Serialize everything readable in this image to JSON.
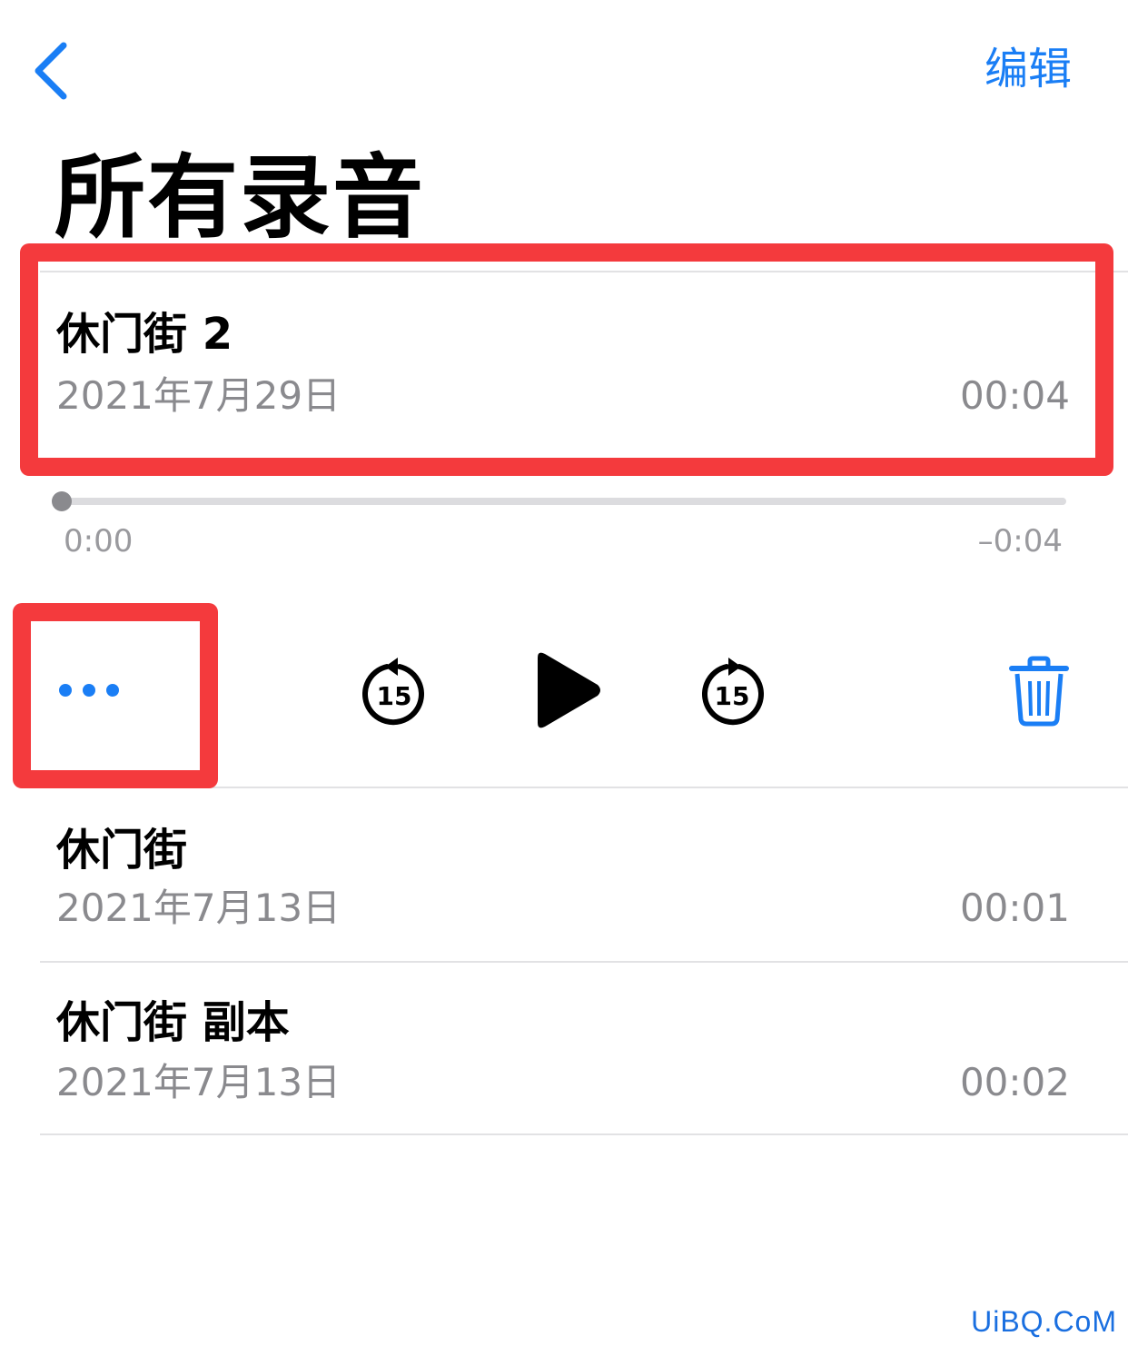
{
  "nav": {
    "back_icon": "chevron-left-icon",
    "edit_label": "编辑",
    "accent_color": "#1a7ef5"
  },
  "title": "所有录音",
  "recordings": [
    {
      "title": "休门街 2",
      "date": "2021年7月29日",
      "duration": "00:04"
    },
    {
      "title": "休门街",
      "date": "2021年7月13日",
      "duration": "00:01"
    },
    {
      "title": "休门街 副本",
      "date": "2021年7月13日",
      "duration": "00:02"
    }
  ],
  "player": {
    "elapsed": "0:00",
    "remaining": "–0:04",
    "progress": 0,
    "skip_back_label": "15",
    "skip_forward_label": "15",
    "icons": [
      "more-icon",
      "skip-back-15-icon",
      "play-icon",
      "skip-forward-15-icon",
      "trash-icon"
    ]
  },
  "annotation_color": "#f43a3d",
  "watermark": "UiBQ.CoM"
}
